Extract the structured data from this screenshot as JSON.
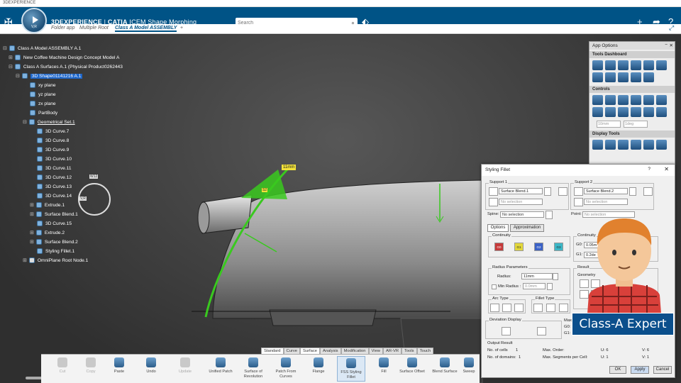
{
  "window": {
    "title": "3DEXPERIENCE"
  },
  "header": {
    "brand_prefix": "3DEXPERIENCE",
    "brand_app": "CATIA",
    "brand_module": "ICEM Shape Morphing",
    "compass_label": "V,R",
    "search_placeholder": "Search"
  },
  "tabs": {
    "items": [
      "Folder app",
      "Multiple Root",
      "Class A Model ASSEMBLY"
    ],
    "add": "+"
  },
  "tree": {
    "rows": [
      {
        "label": "Class A Model ASSEMBLY A.1"
      },
      {
        "label": "New Coffee Machine Design Concept Model A"
      },
      {
        "label": "Class A Surfaces A.1 (Physical Product0262443"
      },
      {
        "label": "3D Shape01141216 A.1"
      },
      {
        "label": "xy plane"
      },
      {
        "label": "yz plane"
      },
      {
        "label": "zx plane"
      },
      {
        "label": "PartBody"
      },
      {
        "label": "Geometrical Set.1"
      },
      {
        "label": "3D Curve.7"
      },
      {
        "label": "3D Curve.8"
      },
      {
        "label": "3D Curve.9"
      },
      {
        "label": "3D Curve.10"
      },
      {
        "label": "3D Curve.11"
      },
      {
        "label": "3D Curve.12"
      },
      {
        "label": "3D Curve.13"
      },
      {
        "label": "3D Curve.14"
      },
      {
        "label": "Extrude.1"
      },
      {
        "label": "Surface Blend.1"
      },
      {
        "label": "3D Curve.15"
      },
      {
        "label": "Extrude.2"
      },
      {
        "label": "Surface Blend.2"
      },
      {
        "label": "Styling Fillet.1"
      },
      {
        "label": "OmniPlane Root Node.1"
      }
    ]
  },
  "viewport": {
    "dimension_label": "11mm",
    "point_label": "S2",
    "compass_w": "W12",
    "compass_v": "V,R"
  },
  "app_options": {
    "title": "App Options",
    "tools_dashboard": "Tools Dashboard",
    "controls": "Controls",
    "display_tools": "Display Tools",
    "field_1": "10mm",
    "field_2": "1deg"
  },
  "fillet": {
    "title": "Styling Fillet",
    "help": "?",
    "support1": "Support 1",
    "support2": "Support 2",
    "s1_value": "Surface Blend.1",
    "s2_value": "Surface Blend.2",
    "no_selection": "No selection",
    "spine_label": "Spine:",
    "point_label": "Point:",
    "tab_options": "Options",
    "tab_approx": "Approximation",
    "continuity": "Continuity",
    "continuity_icons": [
      "G0",
      "G1",
      "G2",
      "G3"
    ],
    "continuity2_title": "Continuity",
    "g0_value": "0.05m",
    "g1_value": "0.2de",
    "radius_params": "Radius Parameters",
    "radius_label": "Radius:",
    "radius_value": "11mm",
    "min_radius_label": "Min Radius :",
    "min_radius_value": "0.0mm",
    "result": "Result",
    "geometry": "Geometry",
    "arc_type": "Arc Type",
    "fillet_type": "Fillet Type",
    "deviation_display": "Deviation Display",
    "max_label": "Max",
    "g0_short": "G0:",
    "g1_short": "G1:",
    "output_result": "Output Result",
    "cells_label": "No. of cells",
    "cells_value": "1",
    "domains_label": "No. of domains:",
    "domains_value": "1",
    "max_order_label": "Max. Order:",
    "max_order_u": "U: 6",
    "max_order_v": "V: 6",
    "max_segments_label": "Max. Segments per Cell:",
    "max_segments_u": "U: 1",
    "max_segments_v": "V: 1",
    "ok": "OK",
    "apply": "Apply",
    "cancel": "Cancel"
  },
  "badge": {
    "text": "Class-A Expert"
  },
  "action_bar": {
    "tabs": [
      "Standard",
      "Curve",
      "Surface",
      "Analysis",
      "Modification",
      "View",
      "AR-VR",
      "Tools",
      "Touch"
    ],
    "tools": [
      {
        "label": "Cut",
        "enabled": false
      },
      {
        "label": "Copy",
        "enabled": false
      },
      {
        "label": "Paste",
        "enabled": true
      },
      {
        "label": "Undo",
        "enabled": true
      },
      {
        "label": "Update",
        "enabled": false
      },
      {
        "label": "Unified Patch",
        "enabled": true
      },
      {
        "label": "Surface of Revolution",
        "enabled": true
      },
      {
        "label": "Patch From Curves",
        "enabled": true
      },
      {
        "label": "Flange",
        "enabled": true
      },
      {
        "label": "FSS Styling Fillet",
        "enabled": true
      },
      {
        "label": "Fill",
        "enabled": true
      },
      {
        "label": "Surface Offset",
        "enabled": true
      },
      {
        "label": "Blend Surface",
        "enabled": true
      },
      {
        "label": "Sweep",
        "enabled": true
      }
    ]
  },
  "colors": {
    "brand": "#005386",
    "selection": "#1e66c9",
    "badge": "#0b4f8c",
    "highlight": "#f3e23a"
  }
}
